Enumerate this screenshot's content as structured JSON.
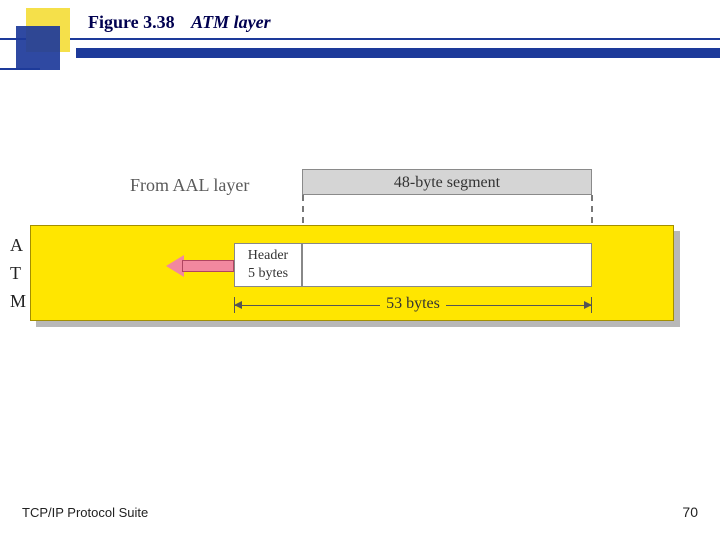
{
  "title": {
    "figure_number": "Figure 3.38",
    "figure_title": "ATM layer"
  },
  "diagram": {
    "from_aal_label": "From AAL layer",
    "segment_label": "48-byte segment",
    "atm_letters": {
      "a": "A",
      "t": "T",
      "m": "M"
    },
    "header_label_line1": "Header",
    "header_label_line2": "5 bytes",
    "cell_length_label": "53 bytes"
  },
  "chart_data": {
    "type": "table",
    "description": "ATM cell structure",
    "segment_bytes": 48,
    "header_bytes": 5,
    "total_cell_bytes": 53,
    "source_layer": "AAL",
    "output_direction": "left (to physical layer)"
  },
  "footer": {
    "left": "TCP/IP Protocol Suite",
    "page": "70"
  }
}
